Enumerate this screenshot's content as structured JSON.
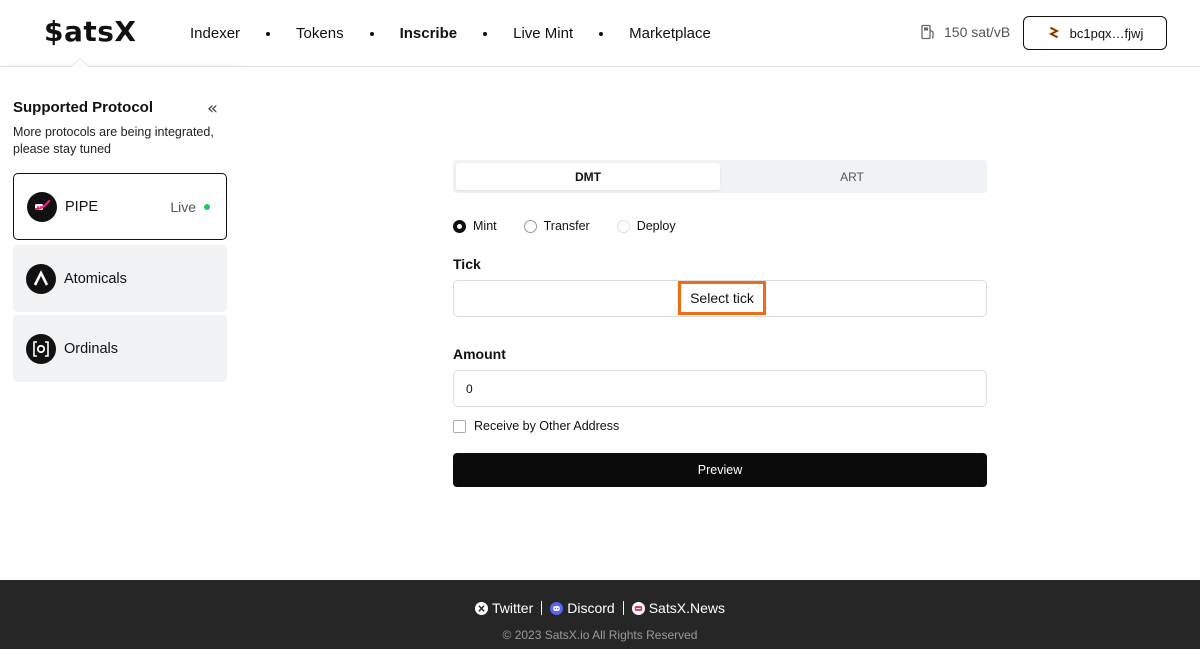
{
  "header": {
    "logo": "$atsX",
    "nav": [
      {
        "label": "Indexer",
        "active": false
      },
      {
        "label": "Tokens",
        "active": false
      },
      {
        "label": "Inscribe",
        "active": true
      },
      {
        "label": "Live Mint",
        "active": false
      },
      {
        "label": "Marketplace",
        "active": false
      }
    ],
    "gas_fee": "150 sat/vB",
    "gas_icon": "fuel-pump-icon",
    "wallet_address": "bc1pqx…fjwj",
    "wallet_icon": "wallet-logo-icon"
  },
  "sidebar": {
    "title": "Supported Protocol",
    "collapse_icon": "«",
    "description": "More protocols are being integrated, please stay tuned",
    "protocols": [
      {
        "label": "PIPE",
        "status": "Live",
        "selected": true,
        "icon": "pipe-logo-icon"
      },
      {
        "label": "Atomicals",
        "selected": false,
        "icon": "atomicals-logo-icon"
      },
      {
        "label": "Ordinals",
        "selected": false,
        "icon": "ordinals-logo-icon"
      }
    ]
  },
  "main": {
    "tabs": [
      {
        "label": "DMT",
        "active": true
      },
      {
        "label": "ART",
        "active": false
      }
    ],
    "actions": [
      {
        "label": "Mint",
        "selected": true
      },
      {
        "label": "Transfer",
        "selected": false
      },
      {
        "label": "Deploy",
        "selected": false
      }
    ],
    "tick_label": "Tick",
    "tick_button": "Select tick",
    "amount_label": "Amount",
    "amount_value": "0",
    "receive_other_label": "Receive by Other Address",
    "preview_button": "Preview"
  },
  "footer": {
    "links": [
      {
        "label": "Twitter",
        "icon": "x-logo-icon"
      },
      {
        "label": "Discord",
        "icon": "discord-icon"
      },
      {
        "label": "SatsX.News",
        "icon": "news-icon"
      }
    ],
    "copyright": "© 2023 SatsX.io All Rights Reserved"
  },
  "colors": {
    "accent_highlight": "#f26b14",
    "live_dot": "#22c55e",
    "primary_button": "#0b0b0b",
    "footer_bg": "#262626"
  }
}
